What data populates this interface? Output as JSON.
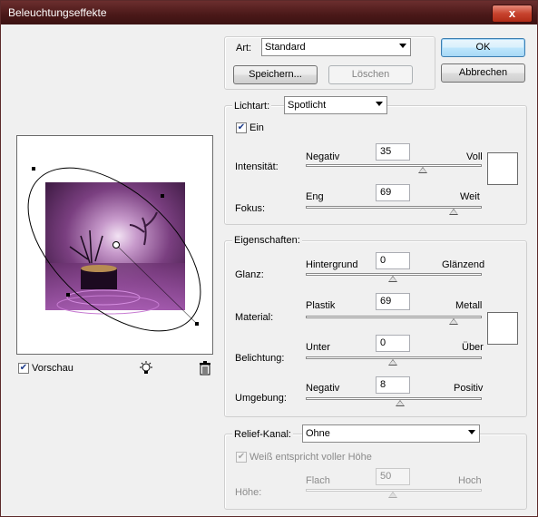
{
  "window": {
    "title": "Beleuchtungseffekte",
    "close_glyph": "x"
  },
  "style": {
    "label": "Art:",
    "value": "Standard",
    "save_button": "Speichern...",
    "delete_button": "Löschen"
  },
  "buttons": {
    "ok": "OK",
    "cancel": "Abbrechen"
  },
  "light": {
    "type_label": "Lichtart:",
    "type_value": "Spotlicht",
    "on_label": "Ein",
    "on_checked": true,
    "intensity": {
      "label": "Intensität:",
      "min_label": "Negativ",
      "max_label": "Voll",
      "value": "35"
    },
    "focus": {
      "label": "Fokus:",
      "min_label": "Eng",
      "max_label": "Weit",
      "value": "69"
    },
    "color": "#ffffff"
  },
  "properties": {
    "group_label": "Eigenschaften:",
    "gloss": {
      "label": "Glanz:",
      "min_label": "Hintergrund",
      "max_label": "Glänzend",
      "value": "0"
    },
    "material": {
      "label": "Material:",
      "min_label": "Plastik",
      "max_label": "Metall",
      "value": "69"
    },
    "exposure": {
      "label": "Belichtung:",
      "min_label": "Unter",
      "max_label": "Über",
      "value": "0"
    },
    "ambience": {
      "label": "Umgebung:",
      "min_label": "Negativ",
      "max_label": "Positiv",
      "value": "8"
    },
    "ambience_color": "#ffffff"
  },
  "texture": {
    "channel_label": "Relief-Kanal:",
    "channel_value": "Ohne",
    "white_is_high_label": "Weiß entspricht voller Höhe",
    "white_is_high_checked": true,
    "height": {
      "label": "Höhe:",
      "min_label": "Flach",
      "max_label": "Hoch",
      "value": "50"
    }
  },
  "preview": {
    "label": "Vorschau",
    "checked": true,
    "light_icon": "light-bulb-icon",
    "trash_icon": "trash-icon"
  }
}
